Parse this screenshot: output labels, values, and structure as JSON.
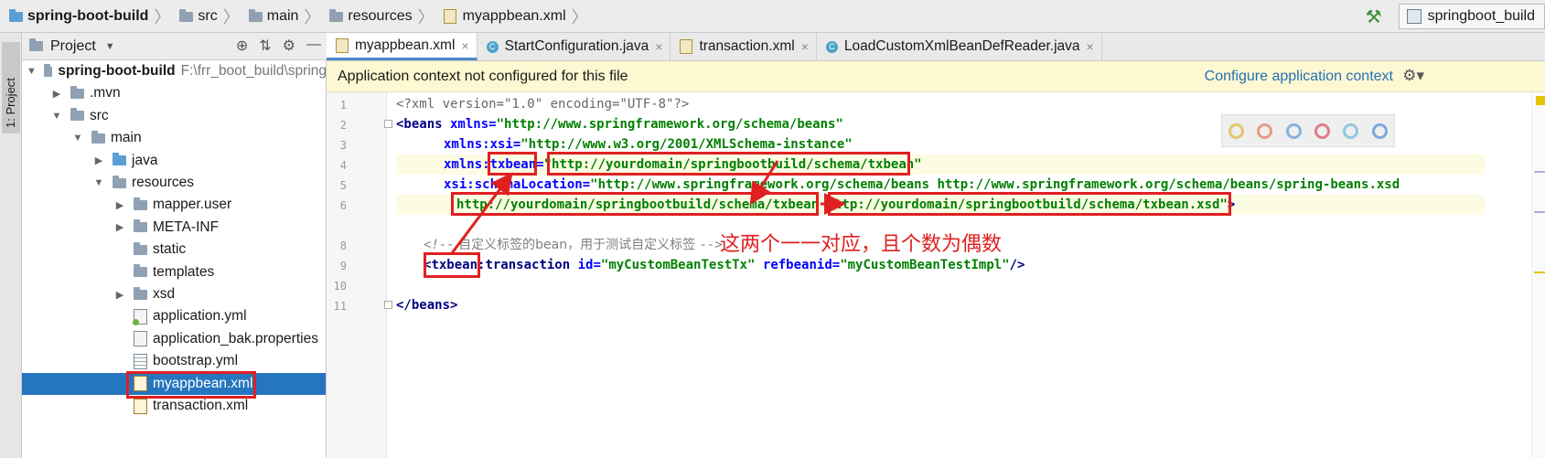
{
  "breadcrumbs": [
    "spring-boot-build",
    "src",
    "main",
    "resources",
    "myappbean.xml"
  ],
  "run_config": "springboot_build",
  "side_tab": "1: Project",
  "project_panel": {
    "title": "Project"
  },
  "tree": [
    {
      "label": "spring-boot-build",
      "path": "F:\\frr_boot_build\\spring",
      "depth": 0,
      "expanded": true,
      "bold": true
    },
    {
      "label": ".mvn",
      "depth": 1,
      "expanded": false
    },
    {
      "label": "src",
      "depth": 1,
      "expanded": true
    },
    {
      "label": "main",
      "depth": 2,
      "expanded": true
    },
    {
      "label": "java",
      "depth": 3,
      "expanded": false
    },
    {
      "label": "resources",
      "depth": 3,
      "expanded": true
    },
    {
      "label": "mapper.user",
      "depth": 4,
      "expanded": false
    },
    {
      "label": "META-INF",
      "depth": 4,
      "expanded": false
    },
    {
      "label": "static",
      "depth": 4
    },
    {
      "label": "templates",
      "depth": 4
    },
    {
      "label": "xsd",
      "depth": 4,
      "expanded": false
    },
    {
      "label": "application.yml",
      "depth": 4,
      "file": "yml"
    },
    {
      "label": "application_bak.properties",
      "depth": 4,
      "file": "props"
    },
    {
      "label": "bootstrap.yml",
      "depth": 4,
      "file": "grid"
    },
    {
      "label": "myappbean.xml",
      "depth": 4,
      "file": "xml",
      "selected": true
    },
    {
      "label": "transaction.xml",
      "depth": 4,
      "file": "xml"
    }
  ],
  "tabs": [
    {
      "label": "myappbean.xml",
      "kind": "xml",
      "active": true
    },
    {
      "label": "StartConfiguration.java",
      "kind": "java"
    },
    {
      "label": "transaction.xml",
      "kind": "xml"
    },
    {
      "label": "LoadCustomXmlBeanDefReader.java",
      "kind": "java"
    }
  ],
  "banner": {
    "message": "Application context not configured for this file",
    "action": "Configure application context"
  },
  "line_numbers": [
    "1",
    "2",
    "3",
    "4",
    "5",
    "6",
    "8",
    "9",
    "10",
    "11"
  ],
  "code": {
    "l1_decl": "<?xml version=\"1.0\" encoding=\"UTF-8\"?>",
    "l2_tag": "<beans",
    "l2_attr": " xmlns=",
    "l2_val": "\"http://www.springframework.org/schema/beans\"",
    "l3_attr": "xmlns:xsi=",
    "l3_val": "\"http://www.w3.org/2001/XMLSchema-instance\"",
    "l4_attr1": "xmlns:",
    "l4_prefix": "txbean",
    "l4_eq": "=",
    "l4_val": "\"http://yourdomain/springbootbuild/schema/txbean\"",
    "l5_attr": "xsi:schemaLocation=",
    "l5_val": "\"http://www.springframework.org/schema/beans http://www.springframework.org/schema/beans/spring-beans.xsd",
    "l6_val": "http://yourdomain/springbootbuild/schema/txbean http://yourdomain/springbootbuild/schema/txbean.xsd\"",
    "l6_close": ">",
    "l8_comment_open": "<!--",
    "l8_comment_text": " 自定义标签的bean，用于测试自定义标签 ",
    "l8_comment_close": "-->",
    "l9_open": "<",
    "l9_prefix": "txbean",
    "l9_tag": ":transaction",
    "l9_attr1": " id=",
    "l9_val1": "\"myCustomBeanTestTx\"",
    "l9_attr2": " refbeanid=",
    "l9_val2": "\"myCustomBeanTestImpl\"",
    "l9_close": "/>",
    "l11": "</beans>"
  },
  "annotation": "这两个一一对应，且个数为偶数",
  "colors": {
    "annotation_red": "#e02020",
    "selection_blue": "#2675bf",
    "banner_yellow": "#fdf8d2",
    "link_blue": "#2470b3"
  },
  "icons": [
    "folder-icon",
    "hammer-icon",
    "gear-icon",
    "settings-icon",
    "collapse-icon",
    "target-icon",
    "chevron-down-icon",
    "close-icon",
    "java-class-icon",
    "xml-file-icon"
  ]
}
